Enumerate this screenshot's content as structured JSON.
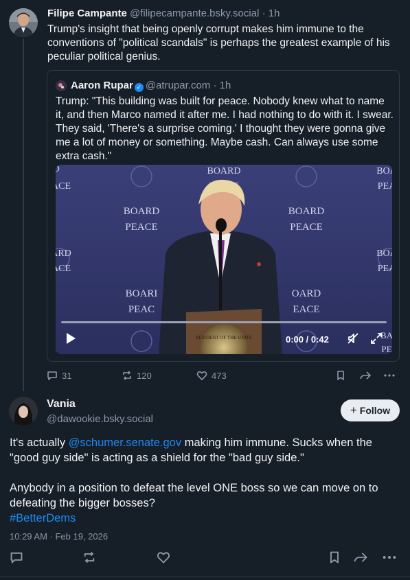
{
  "post1": {
    "author_name": "Filipe Campante",
    "author_handle": "@filipecampante.bsky.social",
    "time": "· 1h",
    "text": "Trump's insight that being openly corrupt makes him immune to the conventions of \"political scandals\" is perhaps the greatest example of his peculiar political genius.",
    "quote": {
      "author_name": "Aaron Rupar",
      "verified_icon": "check-icon",
      "author_handle": "@atrupar.com",
      "time": "· 1h",
      "text": "Trump: \"This building was built for peace. Nobody knew what to name it, and then Marco named it after me. I had nothing to do with it. I swear. They said, 'There's a surprise coming.' I thought they were gonna give me a lot of money or something. Maybe cash. Can always use some extra cash.\"",
      "video": {
        "time_display": "0:00 / 0:42",
        "progress_fraction": 0,
        "backdrop_text": [
          "BOARD",
          "of",
          "PEACE"
        ],
        "partial_backdrop_text": [
          "ARD",
          "ACE",
          "BOA",
          "PEA",
          "BOARI",
          "PEAC",
          "OARD",
          "EACE",
          "BA",
          "PE"
        ],
        "podium_seal_text": "RESIDENT OF THE UNITE"
      }
    },
    "counts": {
      "replies": "31",
      "reposts": "120",
      "likes": "473"
    }
  },
  "post2": {
    "author_name": "Vania",
    "author_handle": "@dawookie.bsky.social",
    "follow_label": "Follow",
    "text_pre": "It's actually ",
    "mention": "@schumer.senate.gov",
    "text_post": " making him immune. Sucks when the \"good guy side\" is acting as a shield for the \"bad guy side.\"",
    "text_para2": "Anybody in a position to defeat the level ONE boss so we can move on to defeating the bigger bosses?",
    "hashtag": "#BetterDems",
    "date": "10:29 AM · Feb 19, 2026"
  },
  "colors": {
    "background": "#161e27",
    "text": "#f1f3f5",
    "muted": "#8c9aab",
    "link": "#1d8af5",
    "border": "#2e3b4b"
  }
}
